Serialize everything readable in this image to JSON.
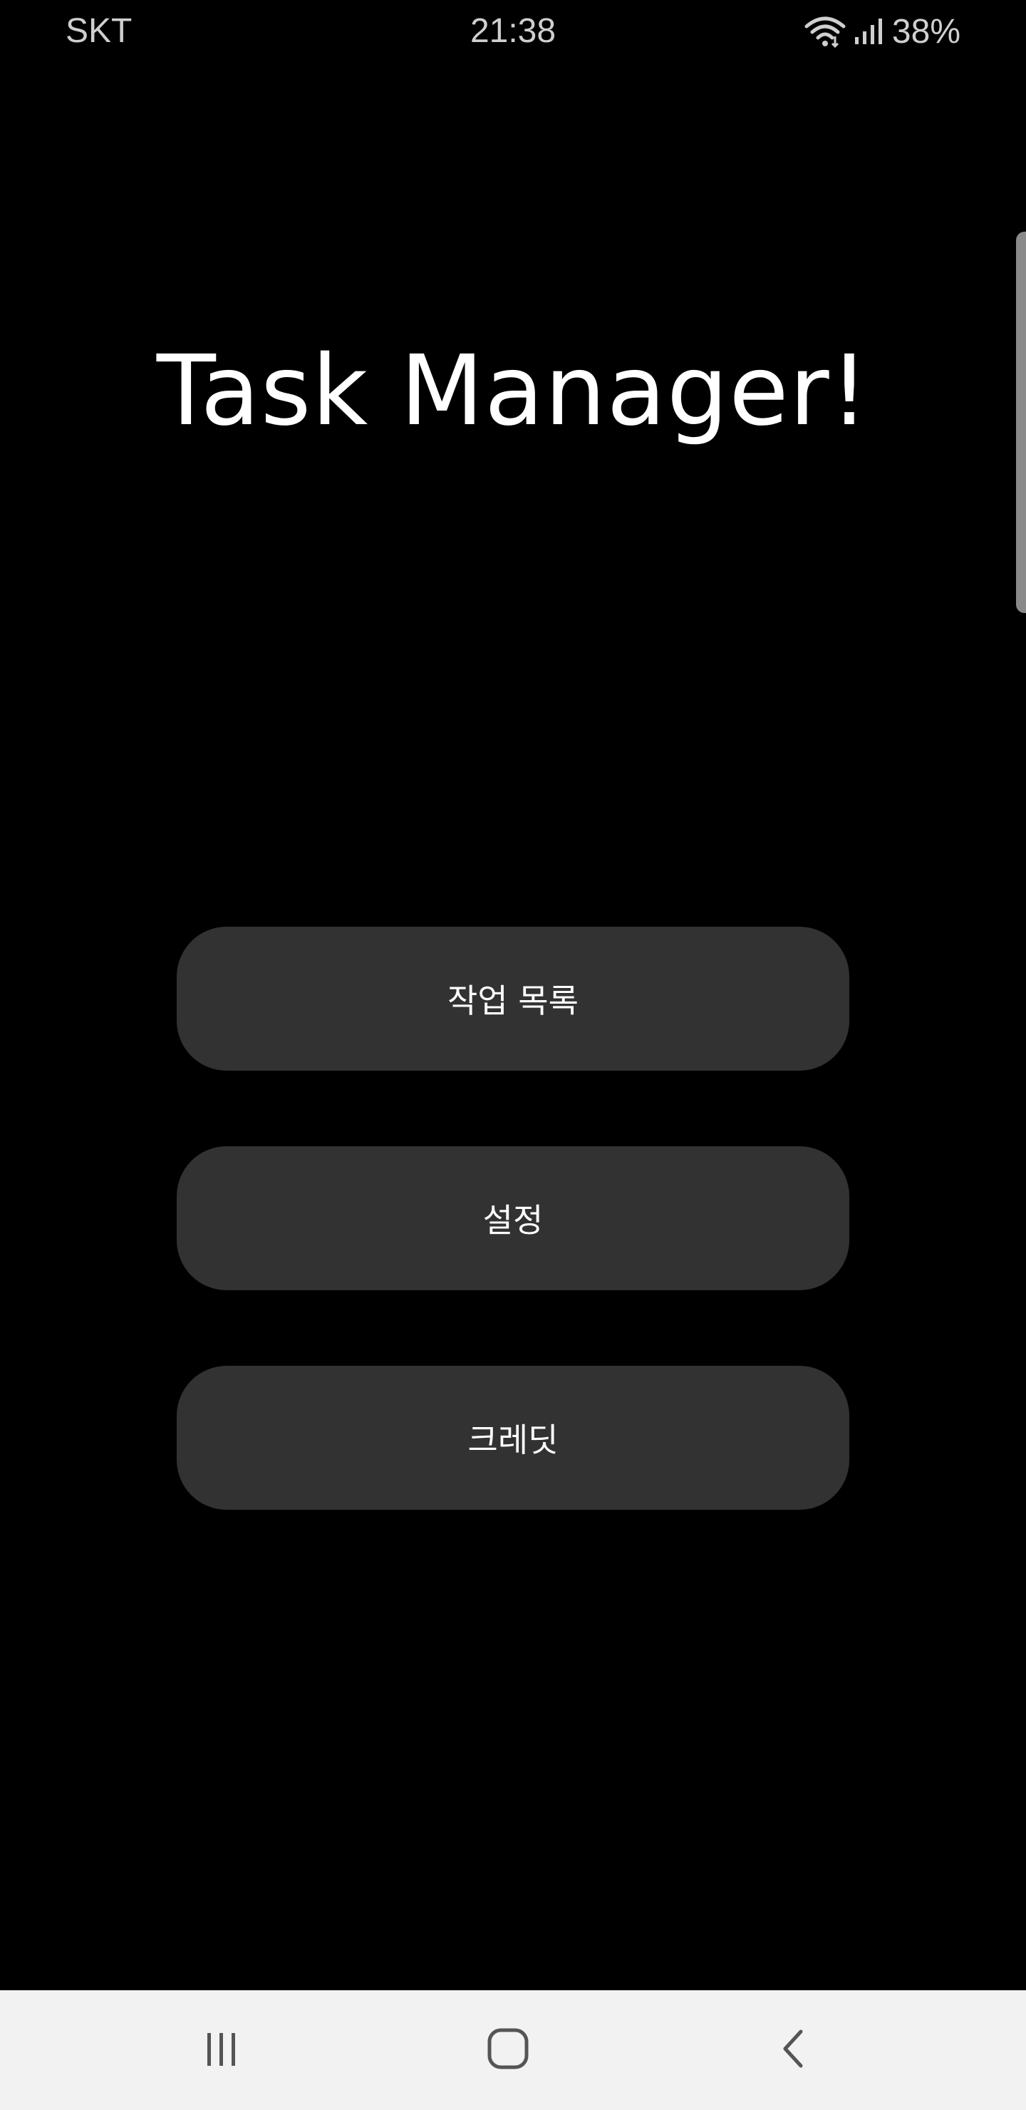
{
  "status_bar": {
    "carrier": "SKT",
    "time": "21:38",
    "battery": "38%",
    "icons": [
      "wifi-icon",
      "signal-icon"
    ]
  },
  "app": {
    "title": "Task Manager!"
  },
  "menu": {
    "items": [
      {
        "label": "작업 목록"
      },
      {
        "label": "설정"
      },
      {
        "label": "크레딧"
      }
    ]
  },
  "nav_bar": {
    "icons": [
      "recent-apps-icon",
      "home-icon",
      "back-icon"
    ]
  },
  "colors": {
    "background": "#000000",
    "button": "#323232",
    "text": "#ffffff",
    "nav_bar": "#f2f2f2",
    "nav_icon": "#555555"
  }
}
